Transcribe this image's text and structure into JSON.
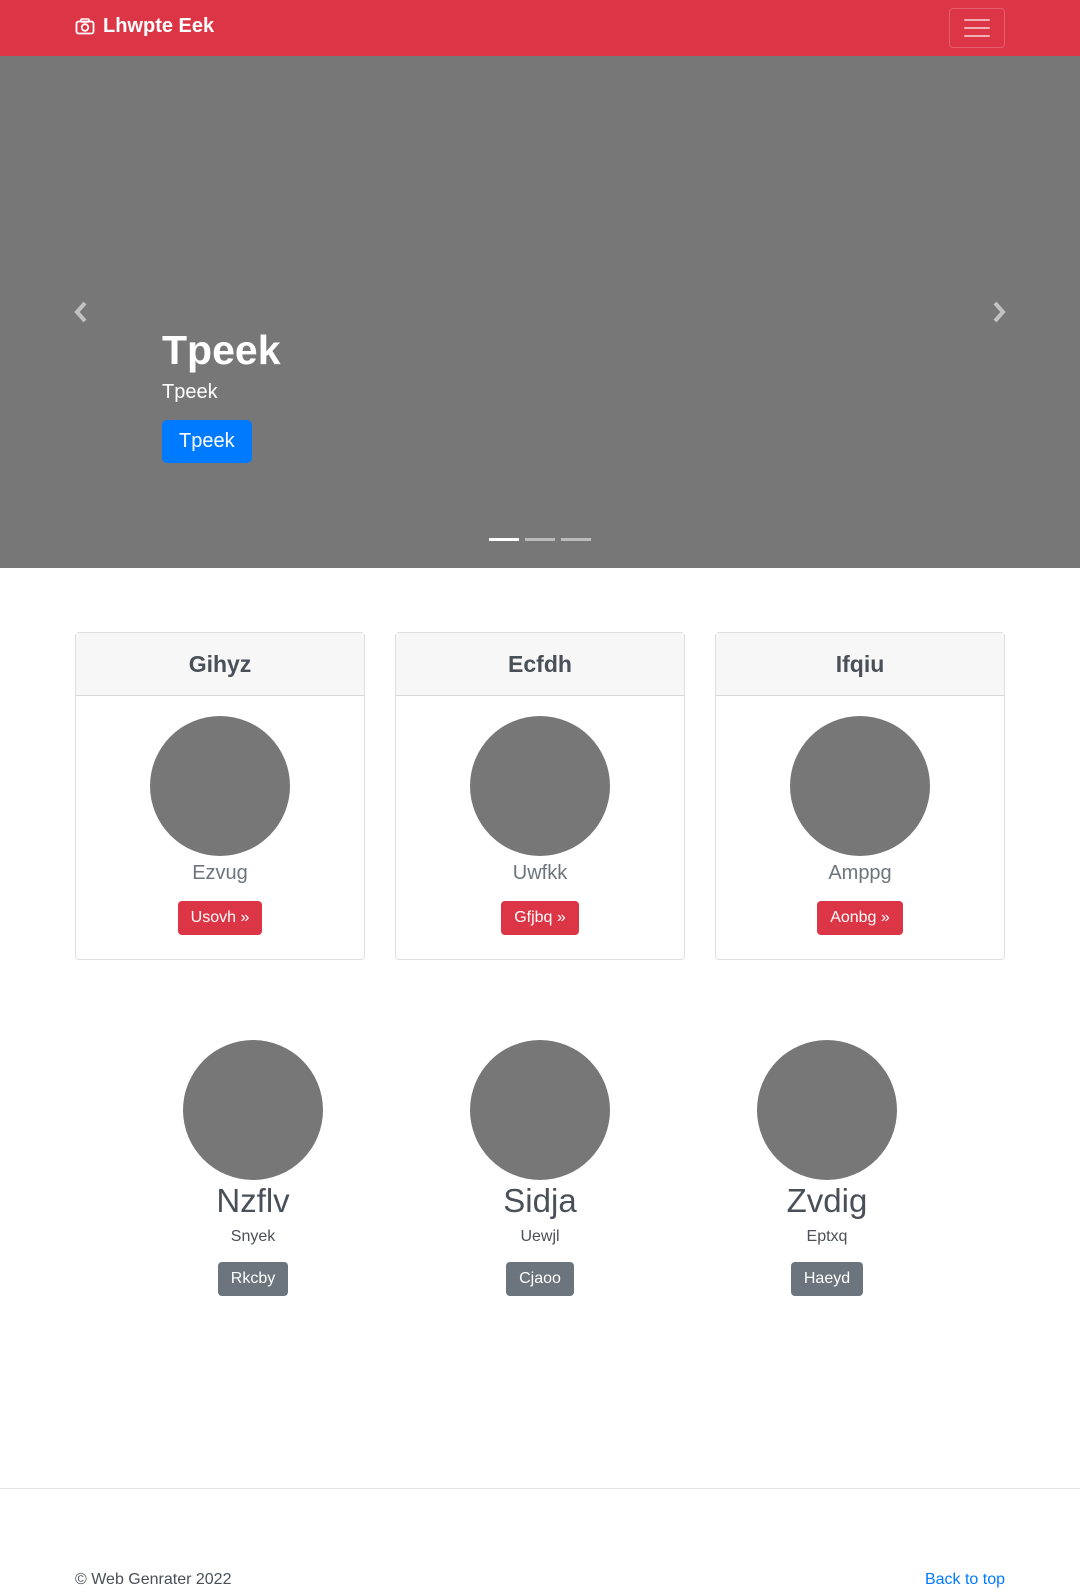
{
  "navbar": {
    "brand": "Lhwpte Eek",
    "brand_icon": "camera-icon",
    "toggler_icon": "hamburger-menu-icon",
    "color": "#dc3545"
  },
  "carousel": {
    "heading": "Tpeek",
    "subtext": "Tpeek",
    "button": "Tpeek",
    "prev_icon": "chevron-left-icon",
    "next_icon": "chevron-right-icon",
    "slide_count": 3,
    "active_slide": 1,
    "background": "#777777"
  },
  "cards": [
    {
      "title": "Gihyz",
      "subtitle": "Ezvug",
      "button": "Usovh »"
    },
    {
      "title": "Ecfdh",
      "subtitle": "Uwfkk",
      "button": "Gfjbq »"
    },
    {
      "title": "Ifqiu",
      "subtitle": "Amppg",
      "button": "Aonbg »"
    }
  ],
  "features": [
    {
      "title": "Nzflv",
      "text": "Snyek",
      "button": "Rkcby"
    },
    {
      "title": "Sidja",
      "text": "Uewjl",
      "button": "Cjaoo"
    },
    {
      "title": "Zvdig",
      "text": "Eptxq",
      "button": "Haeyd"
    }
  ],
  "footer": {
    "copyright": "© Web Genrater 2022",
    "back_to_top": "Back to top"
  }
}
